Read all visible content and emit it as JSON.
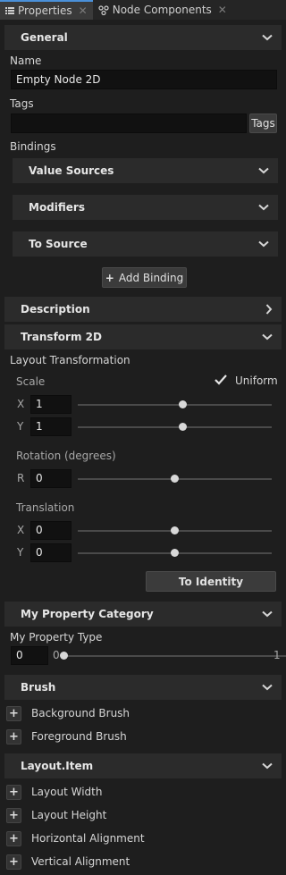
{
  "tabs": [
    {
      "label": "Properties",
      "active": true
    },
    {
      "label": "Node Components",
      "active": false
    }
  ],
  "general": {
    "title": "General",
    "name_label": "Name",
    "name_value": "Empty Node 2D",
    "tags_label": "Tags",
    "tags_value": "",
    "tags_button": "Tags",
    "bindings_label": "Bindings",
    "value_sources": "Value Sources",
    "modifiers": "Modifiers",
    "to_source": "To Source",
    "add_binding": "Add Binding"
  },
  "description": {
    "title": "Description"
  },
  "transform": {
    "title": "Transform 2D",
    "layout_label": "Layout Transformation",
    "scale_label": "Scale",
    "uniform_label": "Uniform",
    "uniform_checked": true,
    "scale_x_axis": "X",
    "scale_x": "1",
    "scale_y_axis": "Y",
    "scale_y": "1",
    "rotation_label": "Rotation (degrees)",
    "rotation_axis": "R",
    "rotation": "0",
    "translation_label": "Translation",
    "translation_x_axis": "X",
    "translation_x": "0",
    "translation_y_axis": "Y",
    "translation_y": "0",
    "to_identity": "To Identity",
    "slider_levels": {
      "scale_x": 0.54,
      "scale_y": 0.54,
      "rotation": 0.5,
      "translation_x": 0.5,
      "translation_y": 0.5
    }
  },
  "my_category": {
    "title": "My Property Category",
    "type_label": "My Property Type",
    "value": "0",
    "min": "0",
    "max": "1",
    "slider_level": 0
  },
  "brush": {
    "title": "Brush",
    "items": [
      "Background Brush",
      "Foreground Brush"
    ]
  },
  "layout_item": {
    "title": "Layout.Item",
    "items": [
      "Layout Width",
      "Layout Height",
      "Horizontal Alignment",
      "Vertical Alignment"
    ]
  },
  "colors": {
    "background": "#1e1e1e",
    "header": "#2b2b2b",
    "field": "#111111",
    "accent": "#4a90d9"
  },
  "icons": {
    "expanded": "chevron-down-icon",
    "collapsed": "chevron-right-icon",
    "add": "plus-icon",
    "check": "checkmark-icon",
    "close": "close-icon",
    "properties": "list-icon",
    "components": "node-components-icon"
  }
}
